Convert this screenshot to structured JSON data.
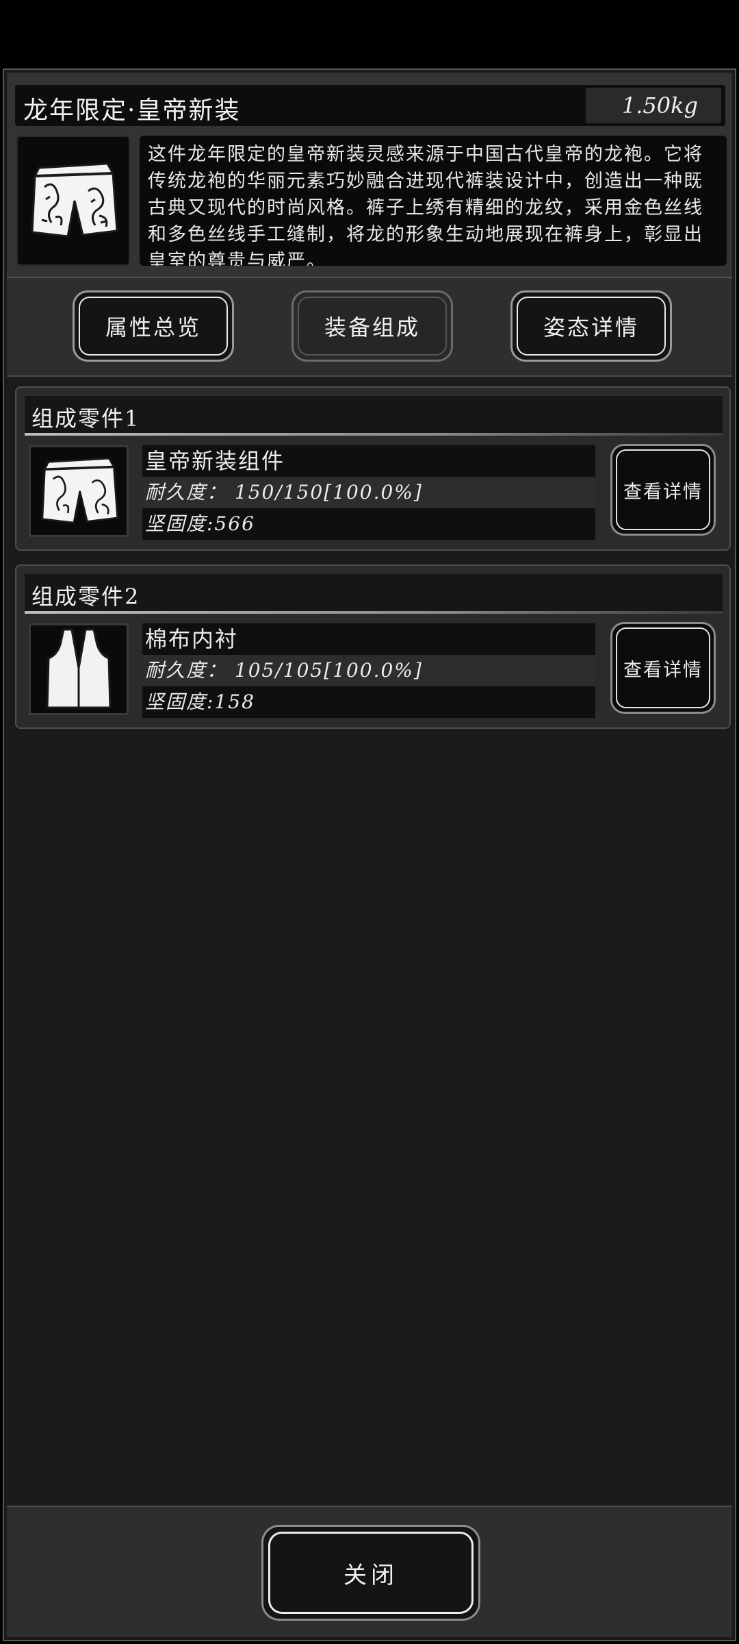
{
  "item": {
    "title": "龙年限定·皇帝新装",
    "weight": "1.50kg",
    "icon": "shorts-icon",
    "description": "这件龙年限定的皇帝新装灵感来源于中国古代皇帝的龙袍。它将传统龙袍的华丽元素巧妙融合进现代裤装设计中，创造出一种既古典又现代的时尚风格。裤子上绣有精细的龙纹，采用金色丝线和多色丝线手工缝制，将龙的形象生动地展现在裤身上，彰显出皇室的尊贵与威严。"
  },
  "tabs": [
    {
      "label": "属性总览",
      "active": false
    },
    {
      "label": "装备组成",
      "active": true
    },
    {
      "label": "姿态详情",
      "active": false
    }
  ],
  "components": [
    {
      "header": "组成零件1",
      "name": "皇帝新装组件",
      "durability": "耐久度： 150/150[100.0%]",
      "hardness": "坚固度:566",
      "icon": "shorts-icon",
      "detail_label": "查看详情"
    },
    {
      "header": "组成零件2",
      "name": "棉布内衬",
      "durability": "耐久度： 105/105[100.0%]",
      "hardness": "坚固度:158",
      "icon": "vest-icon",
      "detail_label": "查看详情"
    }
  ],
  "footer": {
    "close_label": "关闭"
  }
}
